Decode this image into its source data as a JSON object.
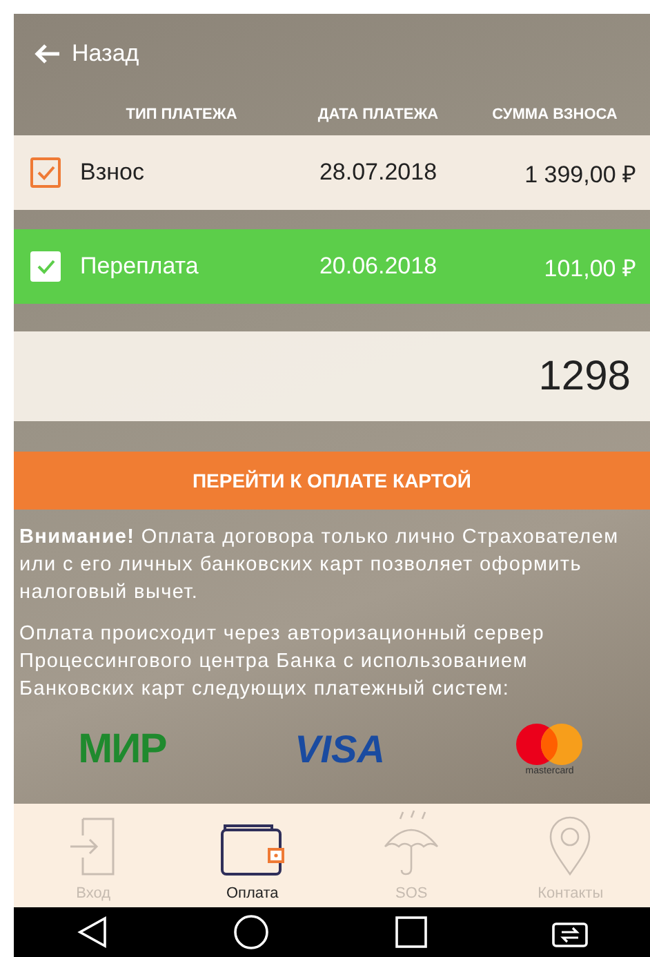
{
  "header": {
    "back_label": "Назад"
  },
  "table": {
    "columns": [
      "ТИП ПЛАТЕЖА",
      "ДАТА ПЛАТЕЖА",
      "СУММА ВЗНОСА"
    ],
    "rows": [
      {
        "type": "Взнос",
        "date": "28.07.2018",
        "amount": "1 399,00 ₽",
        "checked": true,
        "selected": false
      },
      {
        "type": "Переплата",
        "date": "20.06.2018",
        "amount": "101,00 ₽",
        "checked": true,
        "selected": true
      }
    ]
  },
  "amount_field": {
    "value": "1298"
  },
  "pay_button": {
    "label": "ПЕРЕЙТИ К ОПЛАТЕ КАРТОЙ"
  },
  "notes": [
    "**Внимание!** Оплата договора только лично Страхователем или с его личных банковских карт позволяет оформить налоговый вычет.",
    "Оплата происходит через авторизационный сервер Процессингового центра Банка с использованием Банковских карт следующих платежный систем:"
  ],
  "payment_systems": [
    {
      "kind": "mir",
      "label": "МИР"
    },
    {
      "kind": "visa",
      "label": "VISA"
    },
    {
      "kind": "mastercard",
      "label": "mastercard"
    }
  ],
  "tab_bar": [
    {
      "kind": "login",
      "label": "Вход",
      "selected": false
    },
    {
      "kind": "payment",
      "label": "Оплата",
      "selected": true
    },
    {
      "kind": "sos",
      "label": "SOS",
      "selected": false
    },
    {
      "kind": "contacts",
      "label": "Контакты",
      "selected": false
    }
  ]
}
